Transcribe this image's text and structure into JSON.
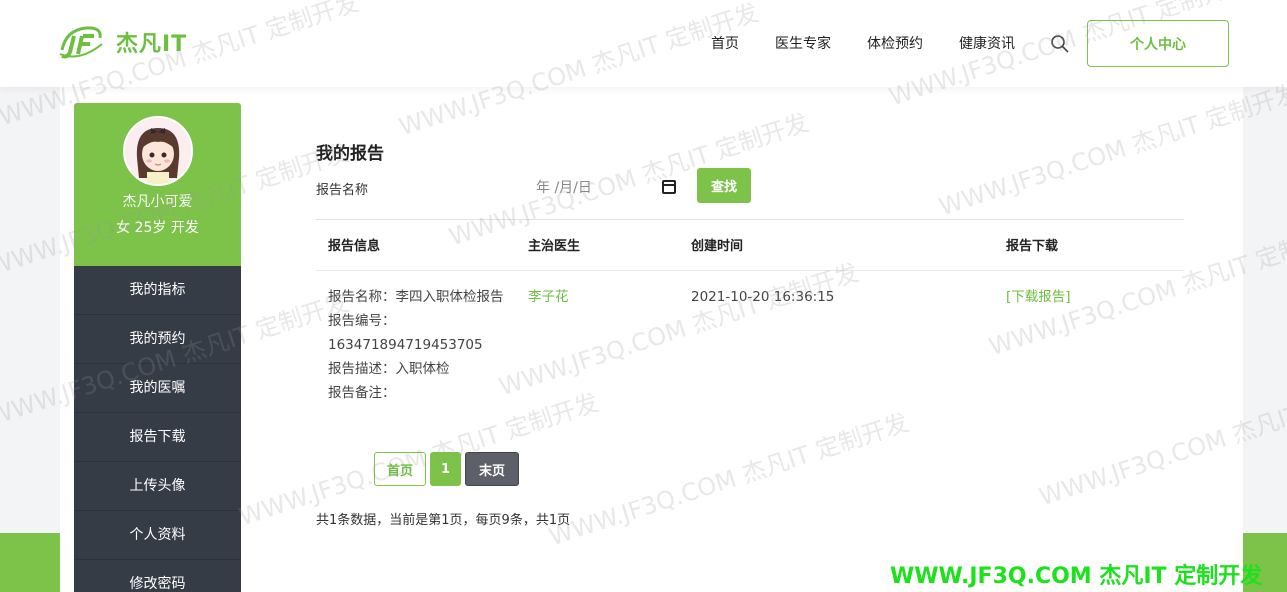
{
  "header": {
    "logo_text": "杰凡IT",
    "nav": [
      "首页",
      "医生专家",
      "体检预约",
      "健康资讯"
    ],
    "user_center": "个人中心"
  },
  "sidebar": {
    "username": "杰凡小可爱",
    "info": "女  25岁  开发",
    "items": [
      "我的指标",
      "我的预约",
      "我的医嘱",
      "报告下载",
      "上传头像",
      "个人资料",
      "修改密码"
    ]
  },
  "main": {
    "title": "我的报告",
    "filter_label": "报告名称",
    "date_placeholder": "年 /月/日",
    "search_button": "查找",
    "columns": [
      "报告信息",
      "主治医生",
      "创建时间",
      "报告下载"
    ],
    "rows": [
      {
        "info": [
          "报告名称：李四入职体检报告",
          "报告编号：163471894719453705",
          "报告描述：入职体检",
          "报告备注："
        ],
        "doctor": "李子花",
        "created": "2021-10-20 16:36:15",
        "download": "[下载报告]"
      }
    ],
    "pagination": {
      "first": "首页",
      "current": "1",
      "last": "末页"
    },
    "summary": "共1条数据，当前是第1页，每页9条，共1页"
  },
  "watermark": {
    "text": "WWW.JF3Q.COM 杰凡IT  定制开发",
    "footer": "WWW.JF3Q.COM 杰凡IT  定制开发"
  },
  "colors": {
    "accent": "#7dc34a",
    "sidebar_bg": "#363c46"
  }
}
